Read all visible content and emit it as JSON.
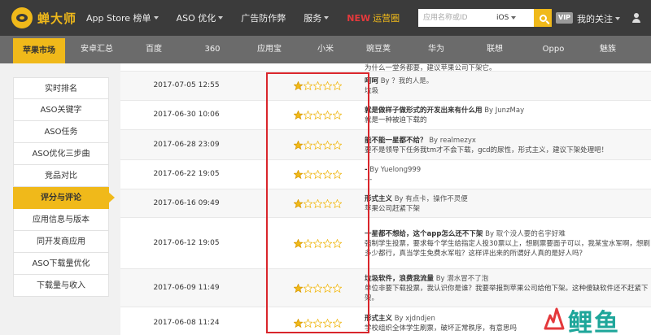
{
  "header": {
    "logo_text": "蝉大师",
    "nav": [
      {
        "label": "App Store 榜单",
        "dropdown": true
      },
      {
        "label": "ASO 优化",
        "dropdown": true
      },
      {
        "label": "广告防作弊",
        "dropdown": false
      },
      {
        "label": "服务",
        "dropdown": true
      },
      {
        "new_tag": "NEW",
        "label": "运营圈",
        "dropdown": false
      }
    ],
    "search": {
      "placeholder": "应用名称或ID",
      "platform": "iOS"
    },
    "vip": "VIP",
    "my_follow": "我的关注"
  },
  "subnav": [
    "苹果市场",
    "安卓汇总",
    "百度",
    "360",
    "应用宝",
    "小米",
    "豌豆荚",
    "华为",
    "联想",
    "Oppo",
    "魅族"
  ],
  "subnav_active": 0,
  "sidebar": {
    "items": [
      "实时排名",
      "ASO关键字",
      "ASO任务",
      "ASO优化三步曲",
      "竞品对比",
      "评分与评论",
      "应用信息与版本",
      "同开发商应用",
      "ASO下载量优化",
      "下载量与收入"
    ],
    "active": 5
  },
  "reviews": [
    {
      "date": "",
      "stars": 0,
      "title": "",
      "author": "",
      "body": "为什么一堂务都要，建议苹果公司下架它。"
    },
    {
      "date": "2017-07-05 12:55",
      "stars": 1,
      "title": "呵呵",
      "author": "By ？我的人是。",
      "body": "垃圾"
    },
    {
      "date": "2017-06-30 10:06",
      "stars": 1,
      "title": "就是做样子做形式的开发出来有什么用",
      "author": "By JunzMay",
      "body": "就是一种被迫下载的"
    },
    {
      "date": "2017-06-28 23:09",
      "stars": 1,
      "title": "能不能一星都不给？",
      "author": "By realmezyx",
      "body": "要不是领导下任务我tm才不会下载，gcd的尿性，形式主义，建议下架处理吧！"
    },
    {
      "date": "2017-06-22 19:05",
      "stars": 1,
      "title": "-",
      "author": "By Yuelong999",
      "body": "---"
    },
    {
      "date": "2017-06-16 09:49",
      "stars": 1,
      "title": "形式主义",
      "author": "By 有点卡，操作不灵便",
      "body": "苹果公司赶紧下架"
    },
    {
      "date": "2017-06-12 19:05",
      "stars": 1,
      "title": "一星都不想给，这个app怎么还不下架",
      "author": "By 取个没人要的名字好难",
      "body": "强制学生投票，要求每个学生给指定人投30票以上，想刷票要面子可以，我某宝水军啊，想刷多少都行，真当学生免费水军啦？这样评出来的所谓好人真的是好人吗？"
    },
    {
      "date": "2017-06-09 11:49",
      "stars": 1,
      "title": "垃圾软件，浪费我流量",
      "author": "By 潜水冒不了泡",
      "body": "单位非要下载投票，我认识你是谁？我要举报到苹果公司给他下架。这种傻缺软件还不赶紧下架。"
    },
    {
      "date": "2017-06-08 11:24",
      "stars": 1,
      "title": "形式主义",
      "author": "By xjdndjen",
      "body": "学校组织全体学生刷票，破坏正常秩序，有意思吗"
    }
  ],
  "watermark_text": "鲤鱼",
  "colors": {
    "accent": "#f0b91a",
    "topbar": "#3b3b3b",
    "subnav": "#6b6b6b",
    "highlight": "#d9262c",
    "star": "#f0b91a"
  }
}
